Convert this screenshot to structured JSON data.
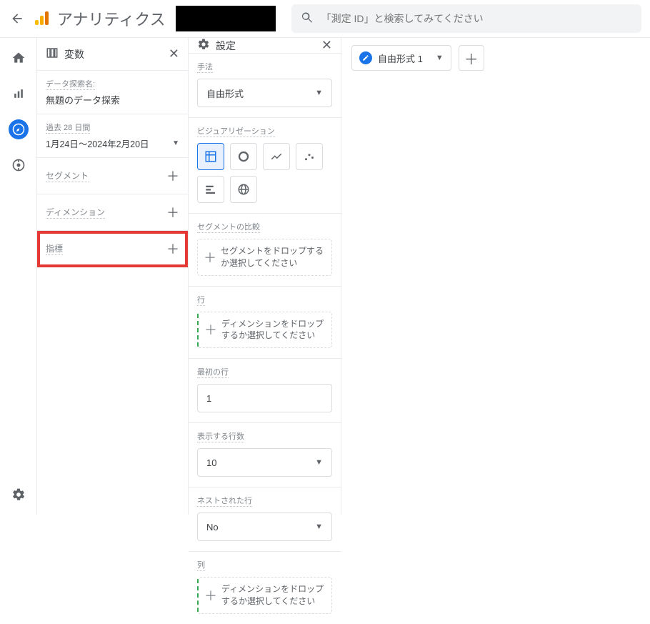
{
  "header": {
    "title": "アナリティクス",
    "search_placeholder": "「測定 ID」と検索してみてください"
  },
  "panels": {
    "variables": {
      "title": "変数",
      "exploration_label": "データ探索名:",
      "exploration_name": "無題のデータ探索",
      "date_label": "過去 28 日間",
      "date_range": "1月24日～2024年2月20日",
      "segment_label": "セグメント",
      "dimension_label": "ディメンション",
      "metric_label": "指標"
    },
    "settings": {
      "title": "設定",
      "technique_label": "手法",
      "technique_value": "自由形式",
      "viz_label": "ビジュアリゼーション",
      "segment_compare_label": "セグメントの比較",
      "segment_drop_text": "セグメントをドロップするか選択してください",
      "rows_label": "行",
      "rows_drop_text": "ディメンションをドロップするか選択してください",
      "first_row_label": "最初の行",
      "first_row_value": "1",
      "rows_show_label": "表示する行数",
      "rows_show_value": "10",
      "nested_rows_label": "ネストされた行",
      "nested_rows_value": "No",
      "cols_label": "列",
      "cols_drop_text": "ディメンションをドロップするか選択してください"
    }
  },
  "canvas": {
    "tab_label": "自由形式 1"
  }
}
